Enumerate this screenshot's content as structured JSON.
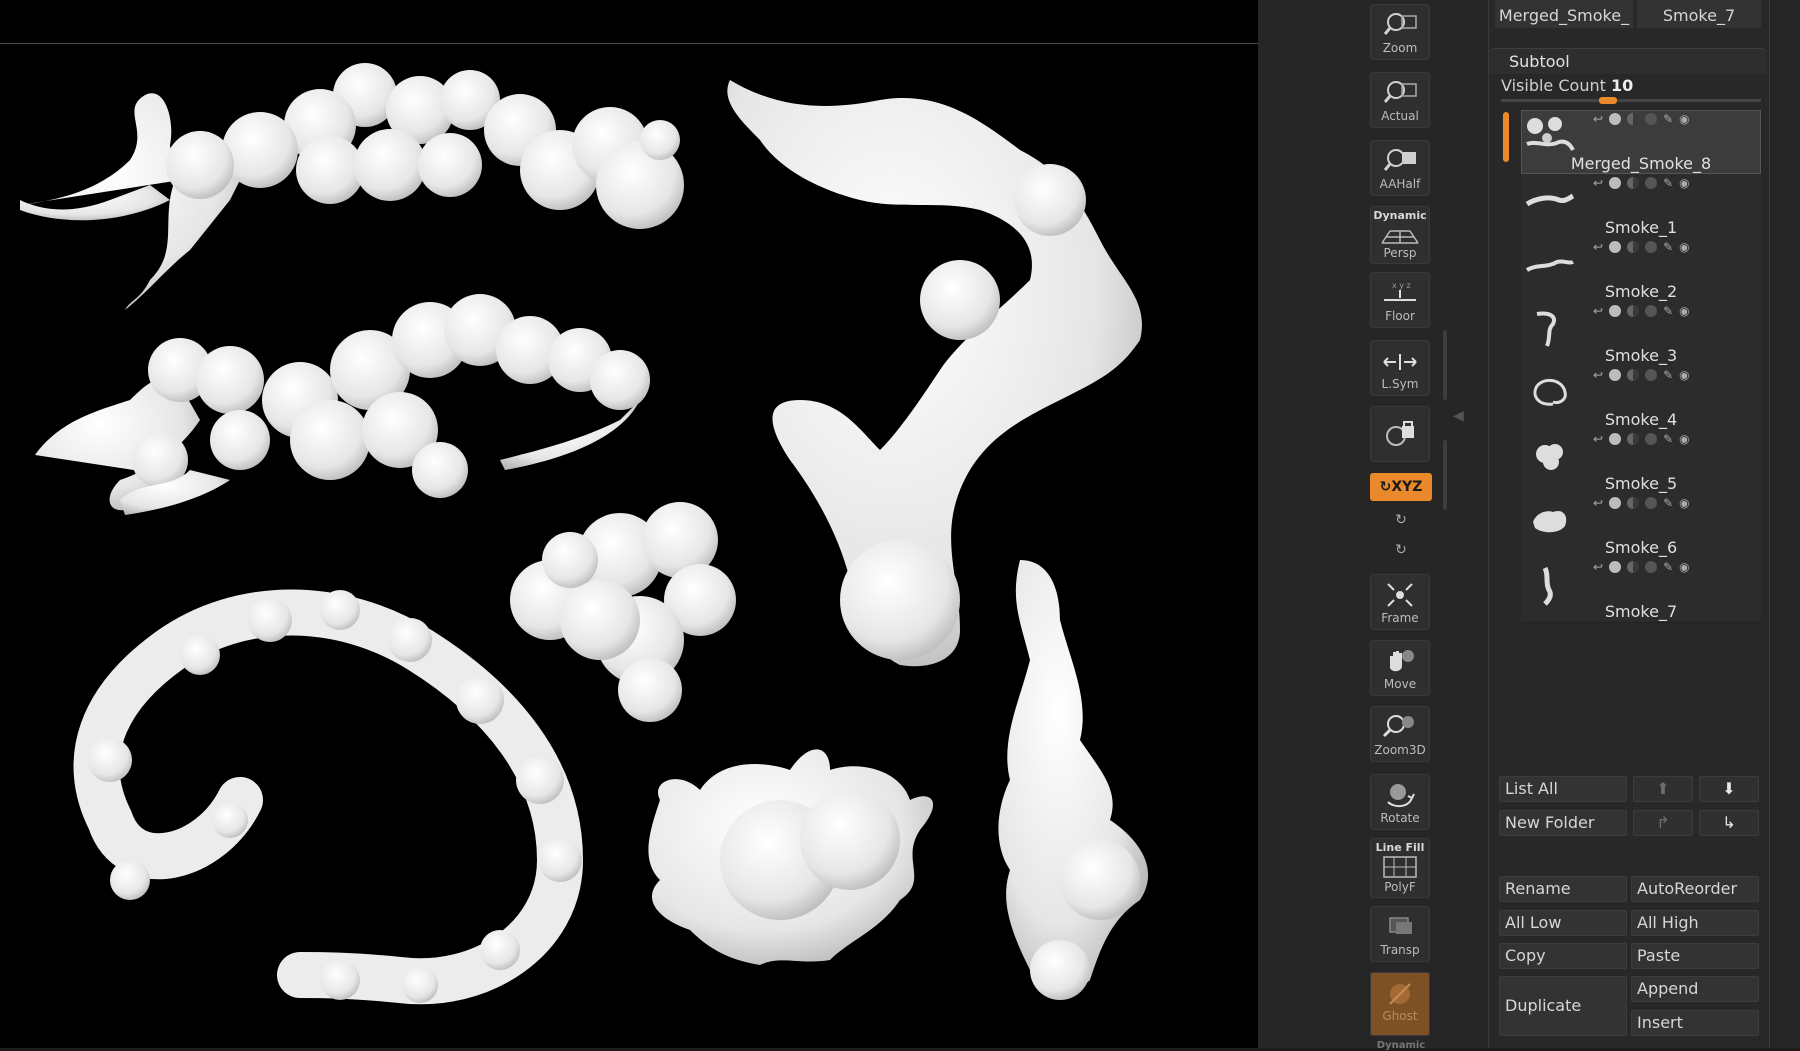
{
  "toolbar": {
    "zoom": "Zoom",
    "actual": "Actual",
    "aahalf": "AAHalf",
    "persp_top": "Dynamic",
    "persp": "Persp",
    "floor": "Floor",
    "lsym": "L.Sym",
    "xyz": "XYZ",
    "frame": "Frame",
    "move": "Move",
    "zoom3d": "Zoom3D",
    "rotate": "Rotate",
    "polyf_top": "Line Fill",
    "polyf": "PolyF",
    "transp": "Transp",
    "ghost": "Ghost",
    "bottom_partial": "Dynamic"
  },
  "thumb_tabs": [
    "Merged_Smoke_",
    "Smoke_7"
  ],
  "subtool": {
    "title": "Subtool",
    "visible_count_label": "Visible Count",
    "visible_count": "10",
    "items": [
      {
        "name": "Merged_Smoke_8",
        "active": true
      },
      {
        "name": "Smoke_1",
        "active": false
      },
      {
        "name": "Smoke_2",
        "active": false
      },
      {
        "name": "Smoke_3",
        "active": false
      },
      {
        "name": "Smoke_4",
        "active": false
      },
      {
        "name": "Smoke_5",
        "active": false
      },
      {
        "name": "Smoke_6",
        "active": false
      },
      {
        "name": "Smoke_7",
        "active": false
      }
    ]
  },
  "buttons": {
    "list_all": "List All",
    "new_folder": "New Folder",
    "rename": "Rename",
    "autoreorder": "AutoReorder",
    "all_low": "All Low",
    "all_high": "All High",
    "copy": "Copy",
    "paste": "Paste",
    "duplicate": "Duplicate",
    "append": "Append",
    "insert": "Insert"
  },
  "colors": {
    "accent": "#e9892b",
    "viewport_bg": "#000000",
    "mesh": "#eeeeee",
    "panel_bg": "#282828"
  }
}
